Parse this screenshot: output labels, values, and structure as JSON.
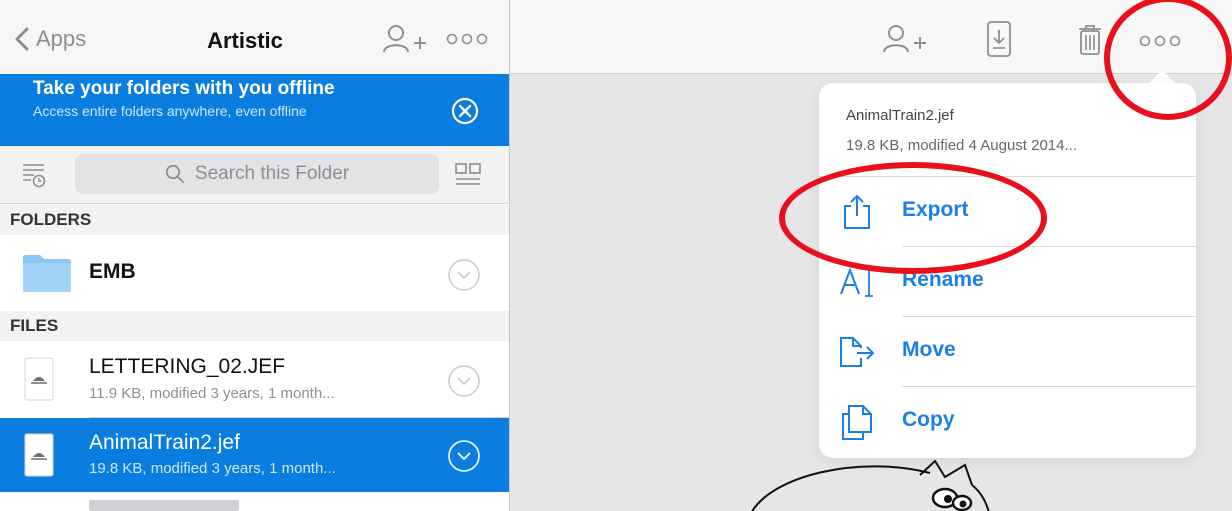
{
  "navbar": {
    "back_label": "Apps",
    "title": "Artistic"
  },
  "banner": {
    "title": "Take your folders with you offline",
    "subtitle": "Access entire folders anywhere, even offline"
  },
  "search": {
    "placeholder": "Search this Folder"
  },
  "sections": {
    "folders": "FOLDERS",
    "files": "FILES"
  },
  "folders": [
    {
      "name": "EMB"
    }
  ],
  "files": [
    {
      "name": "LETTERING_02.JEF",
      "meta": "11.9 KB, modified 3 years, 1 month...",
      "selected": false
    },
    {
      "name": "AnimalTrain2.jef",
      "meta": "19.8 KB, modified 3 years, 1 month...",
      "selected": true
    }
  ],
  "popover": {
    "filename": "AnimalTrain2.jef",
    "meta": "19.8 KB, modified 4 August 2014...",
    "actions": [
      {
        "label": "Export",
        "icon": "share-icon"
      },
      {
        "label": "Rename",
        "icon": "rename-icon"
      },
      {
        "label": "Move",
        "icon": "move-icon"
      },
      {
        "label": "Copy",
        "icon": "copy-icon"
      }
    ]
  },
  "colors": {
    "accent": "#0a7ee0",
    "link": "#1a7fe6",
    "annotation": "#e8101b"
  }
}
